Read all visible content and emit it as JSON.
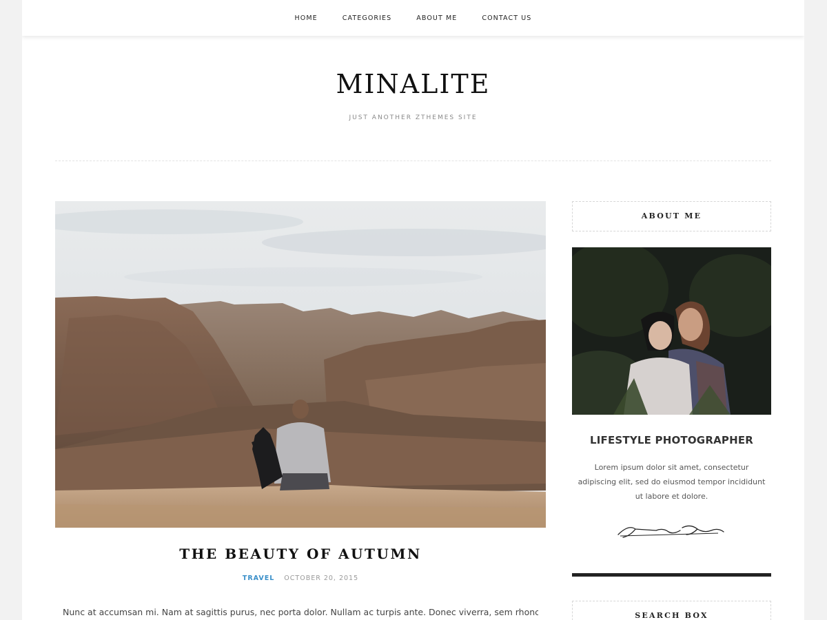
{
  "nav": {
    "items": [
      {
        "label": "HOME"
      },
      {
        "label": "CATEGORIES"
      },
      {
        "label": "ABOUT ME"
      },
      {
        "label": "CONTACT US"
      }
    ]
  },
  "header": {
    "title": "MINALITE",
    "tagline": "JUST ANOTHER ZTHEMES SITE"
  },
  "post": {
    "image_icon": "canyon-photo",
    "title": "THE BEAUTY OF AUTUMN",
    "category": "TRAVEL",
    "date": "OCTOBER 20, 2015",
    "excerpt": "Nunc at accumsan mi. Nam at sagittis purus, nec porta dolor. Nullam ac turpis ante. Donec viverra, sem rhoncus hendrerit"
  },
  "sidebar": {
    "about_title": "ABOUT ME",
    "about_image_icon": "couple-photo",
    "about_heading": "LIFESTYLE PHOTOGRAPHER",
    "about_text": "Lorem ipsum dolor sit amet, consectetur adipiscing elit, sed do eiusmod tempor incididunt ut labore et dolore.",
    "signature_icon": "signature-icon",
    "search_title": "SEARCH BOX"
  },
  "colors": {
    "accent": "#3a8fc9",
    "text": "#111111",
    "meta": "#999999",
    "background": "#f2f2f2"
  }
}
